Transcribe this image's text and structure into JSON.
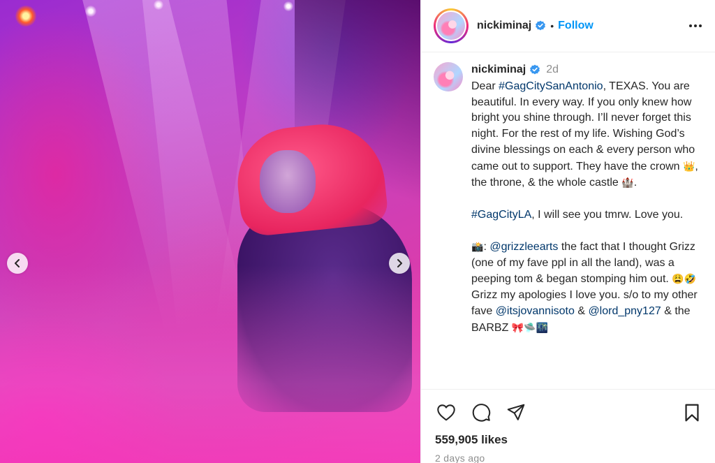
{
  "post": {
    "username": "nickiminaj",
    "verified": true,
    "follow_label": "Follow",
    "separator": "•",
    "time_ago": "2d",
    "caption": {
      "line1_prefix": "Dear ",
      "tag_san_antonio": "#GagCitySanAntonio",
      "line1_rest": ", TEXAS. You are beautiful. In every way. If you only knew how bright you shine through. I’ll never forget this night. For the rest of my life. Wishing God’s divine blessings on each & every person who came out to support. They have the crown ",
      "emoji_crown": "👑",
      "line1_mid": ", the throne, & the whole castle ",
      "emoji_castle": "🏰",
      "line1_end": ".",
      "tag_la": "#GagCityLA",
      "line2_rest": ", I will see you tmrw. Love you.",
      "emoji_camera": "📸",
      "line3_colon": ": ",
      "mention_grizz": "@grizzleearts",
      "line3_rest": " the fact that I thought Grizz (one of my fave ppl in all the land), was a peeping tom & began stomping him out. ",
      "emoji_faces": "😩🤣",
      "line3_rest2": " Grizz my apologies I love you. s/o to my other fave ",
      "mention_jovanni": "@itsjovannisoto",
      "amp": " & ",
      "mention_lord": "@lord_pny127",
      "line3_end": " & the BARBZ ",
      "emoji_end": "🎀🛸🌃"
    },
    "likes": "559,905 likes",
    "date": "2 days ago"
  },
  "icons": {
    "verified": "verified-badge-icon",
    "more": "more-options-icon",
    "prev": "chevron-left-icon",
    "next": "chevron-right-icon",
    "like": "heart-icon",
    "comment": "comment-icon",
    "share": "send-icon",
    "save": "bookmark-icon"
  },
  "colors": {
    "link": "#0095f6",
    "hashtag": "#00376b",
    "muted": "#8e8e8e",
    "verified": "#3897f0"
  }
}
